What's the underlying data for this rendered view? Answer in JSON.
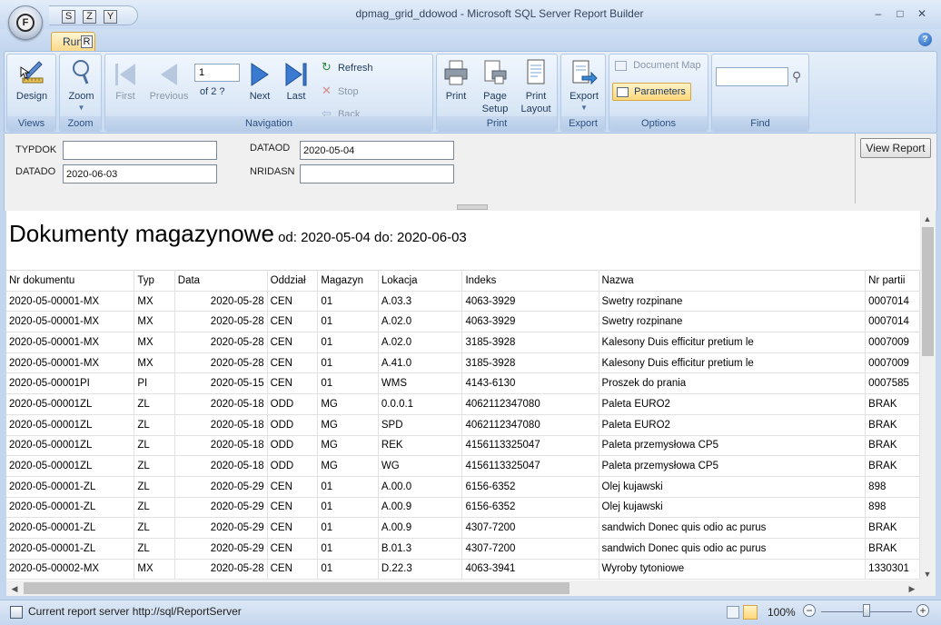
{
  "window": {
    "title": "dpmag_grid_ddowod - Microsoft SQL Server Report Builder",
    "app_button_key": "F",
    "qat_keys": [
      "S",
      "Z",
      "Y"
    ],
    "minimize": "–",
    "maximize": "□",
    "close": "✕"
  },
  "tabs": {
    "run_label": "Run",
    "run_key": "R",
    "help": "?"
  },
  "ribbon": {
    "views": {
      "label": "Views",
      "design": "Design"
    },
    "zoom": {
      "label": "Zoom",
      "zoom": "Zoom"
    },
    "navigation": {
      "label": "Navigation",
      "first": "First",
      "previous": "Previous",
      "page_value": "1",
      "of_text": "of  2 ?",
      "next": "Next",
      "last": "Last",
      "refresh": "Refresh",
      "stop": "Stop",
      "back": "Back"
    },
    "print": {
      "label": "Print",
      "print": "Print",
      "page_setup_1": "Page",
      "page_setup_2": "Setup",
      "print_layout_1": "Print",
      "print_layout_2": "Layout"
    },
    "export": {
      "label": "Export",
      "export": "Export"
    },
    "options": {
      "label": "Options",
      "document_map": "Document Map",
      "parameters": "Parameters"
    },
    "find": {
      "label": "Find",
      "value": ""
    }
  },
  "parameters": {
    "typdok": {
      "label": "TYPDOK",
      "value": ""
    },
    "datado": {
      "label": "DATADO",
      "value": "2020-06-03"
    },
    "dataod": {
      "label": "DATAOD",
      "value": "2020-05-04"
    },
    "nridasn": {
      "label": "NRIDASN",
      "value": ""
    },
    "view_report": "View Report"
  },
  "report": {
    "title": "Dokumenty magazynowe",
    "subtitle": " od: 2020-05-04 do: 2020-06-03",
    "columns": [
      "Nr dokumentu",
      "Typ",
      "Data",
      "Oddział",
      "Magazyn",
      "Lokacja",
      "Indeks",
      "Nazwa",
      "Nr partii"
    ],
    "rows": [
      [
        "2020-05-00001-MX",
        "MX",
        "2020-05-28",
        "CEN",
        "01",
        "A.03.3",
        "4063-3929",
        "Swetry rozpinane",
        "0007014"
      ],
      [
        "2020-05-00001-MX",
        "MX",
        "2020-05-28",
        "CEN",
        "01",
        "A.02.0",
        "4063-3929",
        "Swetry rozpinane",
        "0007014"
      ],
      [
        "2020-05-00001-MX",
        "MX",
        "2020-05-28",
        "CEN",
        "01",
        "A.02.0",
        "3185-3928",
        "Kalesony Duis efficitur pretium le",
        "0007009"
      ],
      [
        "2020-05-00001-MX",
        "MX",
        "2020-05-28",
        "CEN",
        "01",
        "A.41.0",
        "3185-3928",
        "Kalesony Duis efficitur pretium le",
        "0007009"
      ],
      [
        "2020-05-00001PI",
        "PI",
        "2020-05-15",
        "CEN",
        "01",
        "WMS",
        "4143-6130",
        "Proszek do prania",
        "0007585"
      ],
      [
        "2020-05-00001ZL",
        "ZL",
        "2020-05-18",
        "ODD",
        "MG",
        "0.0.0.1",
        "4062112347080",
        "Paleta EURO2",
        "BRAK"
      ],
      [
        "2020-05-00001ZL",
        "ZL",
        "2020-05-18",
        "ODD",
        "MG",
        "SPD",
        "4062112347080",
        "Paleta EURO2",
        "BRAK"
      ],
      [
        "2020-05-00001ZL",
        "ZL",
        "2020-05-18",
        "ODD",
        "MG",
        "REK",
        "4156113325047",
        "Paleta przemysłowa CP5",
        "BRAK"
      ],
      [
        "2020-05-00001ZL",
        "ZL",
        "2020-05-18",
        "ODD",
        "MG",
        "WG",
        "4156113325047",
        "Paleta przemysłowa CP5",
        "BRAK"
      ],
      [
        "2020-05-00001-ZL",
        "ZL",
        "2020-05-29",
        "CEN",
        "01",
        "A.00.0",
        "6156-6352",
        "Olej kujawski",
        "898"
      ],
      [
        "2020-05-00001-ZL",
        "ZL",
        "2020-05-29",
        "CEN",
        "01",
        "A.00.9",
        "6156-6352",
        "Olej kujawski",
        "898"
      ],
      [
        "2020-05-00001-ZL",
        "ZL",
        "2020-05-29",
        "CEN",
        "01",
        "A.00.9",
        "4307-7200",
        "sandwich Donec quis odio ac purus",
        "BRAK"
      ],
      [
        "2020-05-00001-ZL",
        "ZL",
        "2020-05-29",
        "CEN",
        "01",
        "B.01.3",
        "4307-7200",
        "sandwich Donec quis odio ac purus",
        "BRAK"
      ],
      [
        "2020-05-00002-MX",
        "MX",
        "2020-05-28",
        "CEN",
        "01",
        "D.22.3",
        "4063-3941",
        "Wyroby tytoniowe",
        "1330301"
      ]
    ]
  },
  "status": {
    "text": "Current report server http://sql/ReportServer",
    "zoom": "100%",
    "zoom_fraction": 0.5,
    "minus": "−",
    "plus": "+"
  }
}
